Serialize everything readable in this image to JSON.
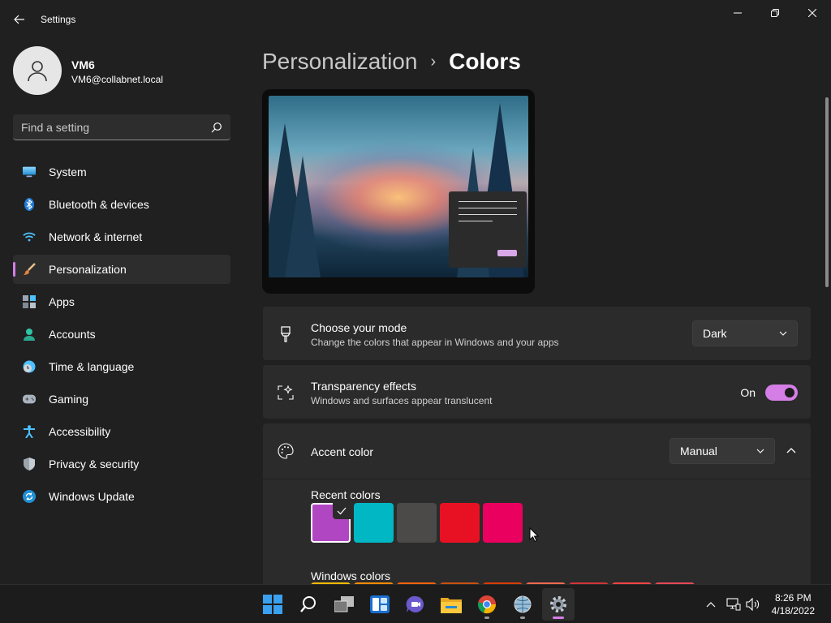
{
  "window": {
    "title": "Settings"
  },
  "user": {
    "name": "VM6",
    "email": "VM6@collabnet.local"
  },
  "search": {
    "placeholder": "Find a setting"
  },
  "sidebar": {
    "items": [
      {
        "label": "System",
        "icon": "monitor-icon"
      },
      {
        "label": "Bluetooth & devices",
        "icon": "bluetooth-icon"
      },
      {
        "label": "Network & internet",
        "icon": "wifi-icon"
      },
      {
        "label": "Personalization",
        "icon": "brush-icon",
        "active": true
      },
      {
        "label": "Apps",
        "icon": "apps-icon"
      },
      {
        "label": "Accounts",
        "icon": "person-icon"
      },
      {
        "label": "Time & language",
        "icon": "clock-globe-icon"
      },
      {
        "label": "Gaming",
        "icon": "gamepad-icon"
      },
      {
        "label": "Accessibility",
        "icon": "accessibility-icon"
      },
      {
        "label": "Privacy & security",
        "icon": "shield-icon"
      },
      {
        "label": "Windows Update",
        "icon": "update-icon"
      }
    ]
  },
  "breadcrumb": {
    "parent": "Personalization",
    "separator": "›",
    "current": "Colors"
  },
  "mode": {
    "title": "Choose your mode",
    "description": "Change the colors that appear in Windows and your apps",
    "value": "Dark"
  },
  "transparency": {
    "title": "Transparency effects",
    "description": "Windows and surfaces appear translucent",
    "state_label": "On",
    "enabled": true
  },
  "accent": {
    "title": "Accent color",
    "value": "Manual",
    "recent_label": "Recent colors",
    "recent_colors": [
      "#b146c2",
      "#00b7c3",
      "#4c4a48",
      "#e81123",
      "#ea005e"
    ],
    "selected_index": 0,
    "windows_label": "Windows colors",
    "windows_colors": [
      "#ffb900",
      "#ff8c00",
      "#f7630c",
      "#ca5010",
      "#da3b01",
      "#ef6950",
      "#d13438",
      "#ff4343",
      "#e74856"
    ]
  },
  "colors": {
    "accent": "#d47ee6",
    "background": "#202020",
    "card": "#2b2b2b"
  },
  "taskbar": {
    "apps": [
      "start-icon",
      "search-icon",
      "task-view-icon",
      "widgets-icon",
      "teams-chat-icon",
      "file-explorer-icon",
      "chrome-icon",
      "network-globe-icon",
      "settings-icon"
    ],
    "time": "8:26 PM",
    "date": "4/18/2022"
  }
}
